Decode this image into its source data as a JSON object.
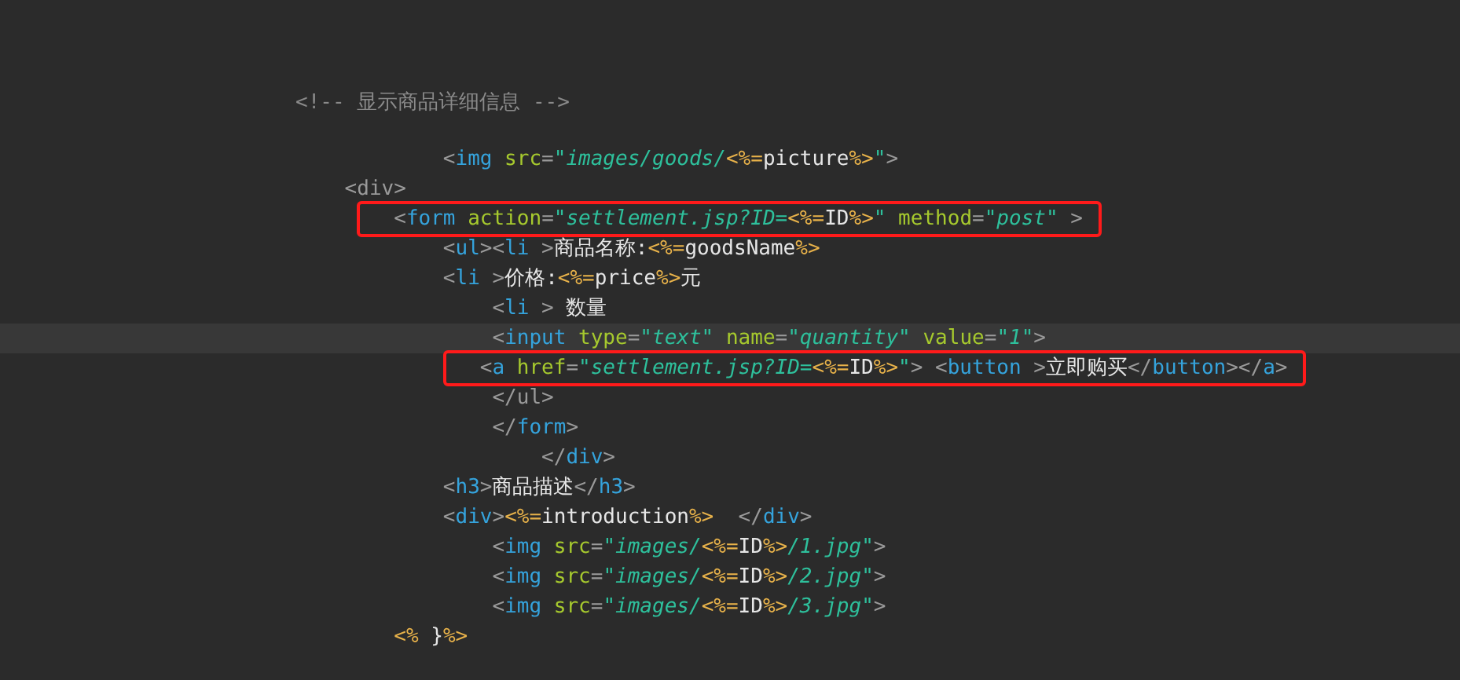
{
  "comment": "<!-- 显示商品详细信息 -->",
  "lines": [
    {
      "current": false,
      "boxed": false,
      "tokens": [
        {
          "kind": "p",
          "text": "            <"
        },
        {
          "kind": "tag",
          "text": "img"
        },
        {
          "kind": "attr",
          "text": " src"
        },
        {
          "kind": "p",
          "text": "="
        },
        {
          "kind": "str",
          "text": "\"images/goods/"
        },
        {
          "kind": "jsp",
          "text": "<%="
        },
        {
          "kind": "txt",
          "text": "picture"
        },
        {
          "kind": "jsp",
          "text": "%>"
        },
        {
          "kind": "str",
          "text": "\""
        },
        {
          "kind": "p",
          "text": ">"
        }
      ]
    },
    {
      "current": false,
      "boxed": false,
      "tokens": [
        {
          "kind": "p",
          "text": "    <div>"
        }
      ]
    },
    {
      "current": false,
      "boxed": true,
      "tokens": [
        {
          "kind": "p",
          "text": "        <"
        },
        {
          "kind": "tag",
          "text": "form"
        },
        {
          "kind": "attr",
          "text": " action"
        },
        {
          "kind": "p",
          "text": "="
        },
        {
          "kind": "str",
          "text": "\"settlement.jsp?ID="
        },
        {
          "kind": "jsp",
          "text": "<%="
        },
        {
          "kind": "txt",
          "text": "ID"
        },
        {
          "kind": "jsp",
          "text": "%>"
        },
        {
          "kind": "str",
          "text": "\""
        },
        {
          "kind": "attr",
          "text": " method"
        },
        {
          "kind": "p",
          "text": "="
        },
        {
          "kind": "str",
          "text": "\"post\""
        },
        {
          "kind": "p",
          "text": " >"
        }
      ]
    },
    {
      "current": false,
      "boxed": false,
      "tokens": [
        {
          "kind": "p",
          "text": "            <"
        },
        {
          "kind": "tag",
          "text": "ul"
        },
        {
          "kind": "p",
          "text": "><"
        },
        {
          "kind": "tag",
          "text": "li"
        },
        {
          "kind": "p",
          "text": " >"
        },
        {
          "kind": "txt",
          "text": "商品名称:"
        },
        {
          "kind": "jsp",
          "text": "<%="
        },
        {
          "kind": "txt",
          "text": "goodsName"
        },
        {
          "kind": "jsp",
          "text": "%>"
        }
      ]
    },
    {
      "current": false,
      "boxed": false,
      "tokens": [
        {
          "kind": "p",
          "text": "            <"
        },
        {
          "kind": "tag",
          "text": "li"
        },
        {
          "kind": "p",
          "text": " >"
        },
        {
          "kind": "txt",
          "text": "价格:"
        },
        {
          "kind": "jsp",
          "text": "<%="
        },
        {
          "kind": "txt",
          "text": "price"
        },
        {
          "kind": "jsp",
          "text": "%>"
        },
        {
          "kind": "txt",
          "text": "元"
        }
      ]
    },
    {
      "current": false,
      "boxed": false,
      "tokens": [
        {
          "kind": "p",
          "text": "                <"
        },
        {
          "kind": "tag",
          "text": "li"
        },
        {
          "kind": "p",
          "text": " >"
        },
        {
          "kind": "txt",
          "text": " 数量"
        }
      ]
    },
    {
      "current": true,
      "boxed": false,
      "tokens": [
        {
          "kind": "p",
          "text": "                <"
        },
        {
          "kind": "tag",
          "text": "input"
        },
        {
          "kind": "attr",
          "text": " type"
        },
        {
          "kind": "p",
          "text": "="
        },
        {
          "kind": "str",
          "text": "\"text\""
        },
        {
          "kind": "attr",
          "text": " name"
        },
        {
          "kind": "p",
          "text": "="
        },
        {
          "kind": "str",
          "text": "\"quantity\""
        },
        {
          "kind": "attr",
          "text": " value"
        },
        {
          "kind": "p",
          "text": "="
        },
        {
          "kind": "str",
          "text": "\"1\""
        },
        {
          "kind": "p",
          "text": ">"
        }
      ]
    },
    {
      "current": false,
      "boxed": true,
      "tokens": [
        {
          "kind": "p",
          "text": "               <"
        },
        {
          "kind": "tag",
          "text": "a"
        },
        {
          "kind": "attr",
          "text": " href"
        },
        {
          "kind": "p",
          "text": "="
        },
        {
          "kind": "str",
          "text": "\"settlement.jsp?ID="
        },
        {
          "kind": "jsp",
          "text": "<%="
        },
        {
          "kind": "txt",
          "text": "ID"
        },
        {
          "kind": "jsp",
          "text": "%>"
        },
        {
          "kind": "str",
          "text": "\""
        },
        {
          "kind": "p",
          "text": "> <"
        },
        {
          "kind": "tag",
          "text": "button"
        },
        {
          "kind": "p",
          "text": " >"
        },
        {
          "kind": "txt",
          "text": "立即购买"
        },
        {
          "kind": "p",
          "text": "</"
        },
        {
          "kind": "tag",
          "text": "button"
        },
        {
          "kind": "p",
          "text": "></"
        },
        {
          "kind": "tag",
          "text": "a"
        },
        {
          "kind": "p",
          "text": ">"
        }
      ]
    },
    {
      "current": false,
      "boxed": false,
      "tokens": [
        {
          "kind": "p",
          "text": "                </ul>"
        }
      ]
    },
    {
      "current": false,
      "boxed": false,
      "tokens": [
        {
          "kind": "p",
          "text": "                </"
        },
        {
          "kind": "tag",
          "text": "form"
        },
        {
          "kind": "p",
          "text": ">"
        }
      ]
    },
    {
      "current": false,
      "boxed": false,
      "tokens": [
        {
          "kind": "p",
          "text": "                    </"
        },
        {
          "kind": "tag",
          "text": "div"
        },
        {
          "kind": "p",
          "text": ">"
        }
      ]
    },
    {
      "current": false,
      "boxed": false,
      "tokens": [
        {
          "kind": "p",
          "text": "            <"
        },
        {
          "kind": "tag",
          "text": "h3"
        },
        {
          "kind": "p",
          "text": ">"
        },
        {
          "kind": "txt",
          "text": "商品描述"
        },
        {
          "kind": "p",
          "text": "</"
        },
        {
          "kind": "tag",
          "text": "h3"
        },
        {
          "kind": "p",
          "text": ">"
        }
      ]
    },
    {
      "current": false,
      "boxed": false,
      "tokens": [
        {
          "kind": "p",
          "text": "            <"
        },
        {
          "kind": "tag",
          "text": "div"
        },
        {
          "kind": "p",
          "text": ">"
        },
        {
          "kind": "jsp",
          "text": "<%="
        },
        {
          "kind": "txt",
          "text": "introduction"
        },
        {
          "kind": "jsp",
          "text": "%>"
        },
        {
          "kind": "p",
          "text": "  </"
        },
        {
          "kind": "tag",
          "text": "div"
        },
        {
          "kind": "p",
          "text": ">"
        }
      ]
    },
    {
      "current": false,
      "boxed": false,
      "tokens": [
        {
          "kind": "p",
          "text": "                <"
        },
        {
          "kind": "tag",
          "text": "img"
        },
        {
          "kind": "attr",
          "text": " src"
        },
        {
          "kind": "p",
          "text": "="
        },
        {
          "kind": "str",
          "text": "\"images/"
        },
        {
          "kind": "jsp",
          "text": "<%="
        },
        {
          "kind": "txt",
          "text": "ID"
        },
        {
          "kind": "jsp",
          "text": "%>"
        },
        {
          "kind": "str",
          "text": "/1.jpg\""
        },
        {
          "kind": "p",
          "text": ">"
        }
      ]
    },
    {
      "current": false,
      "boxed": false,
      "tokens": [
        {
          "kind": "p",
          "text": "                <"
        },
        {
          "kind": "tag",
          "text": "img"
        },
        {
          "kind": "attr",
          "text": " src"
        },
        {
          "kind": "p",
          "text": "="
        },
        {
          "kind": "str",
          "text": "\"images/"
        },
        {
          "kind": "jsp",
          "text": "<%="
        },
        {
          "kind": "txt",
          "text": "ID"
        },
        {
          "kind": "jsp",
          "text": "%>"
        },
        {
          "kind": "str",
          "text": "/2.jpg\""
        },
        {
          "kind": "p",
          "text": ">"
        }
      ]
    },
    {
      "current": false,
      "boxed": false,
      "tokens": [
        {
          "kind": "p",
          "text": "                <"
        },
        {
          "kind": "tag",
          "text": "img"
        },
        {
          "kind": "attr",
          "text": " src"
        },
        {
          "kind": "p",
          "text": "="
        },
        {
          "kind": "str",
          "text": "\"images/"
        },
        {
          "kind": "jsp",
          "text": "<%="
        },
        {
          "kind": "txt",
          "text": "ID"
        },
        {
          "kind": "jsp",
          "text": "%>"
        },
        {
          "kind": "str",
          "text": "/3.jpg\""
        },
        {
          "kind": "p",
          "text": ">"
        }
      ]
    },
    {
      "current": false,
      "boxed": false,
      "tokens": [
        {
          "kind": "jsp",
          "text": "        <%"
        },
        {
          "kind": "txt",
          "text": " }"
        },
        {
          "kind": "jsp",
          "text": "%>"
        }
      ]
    }
  ]
}
